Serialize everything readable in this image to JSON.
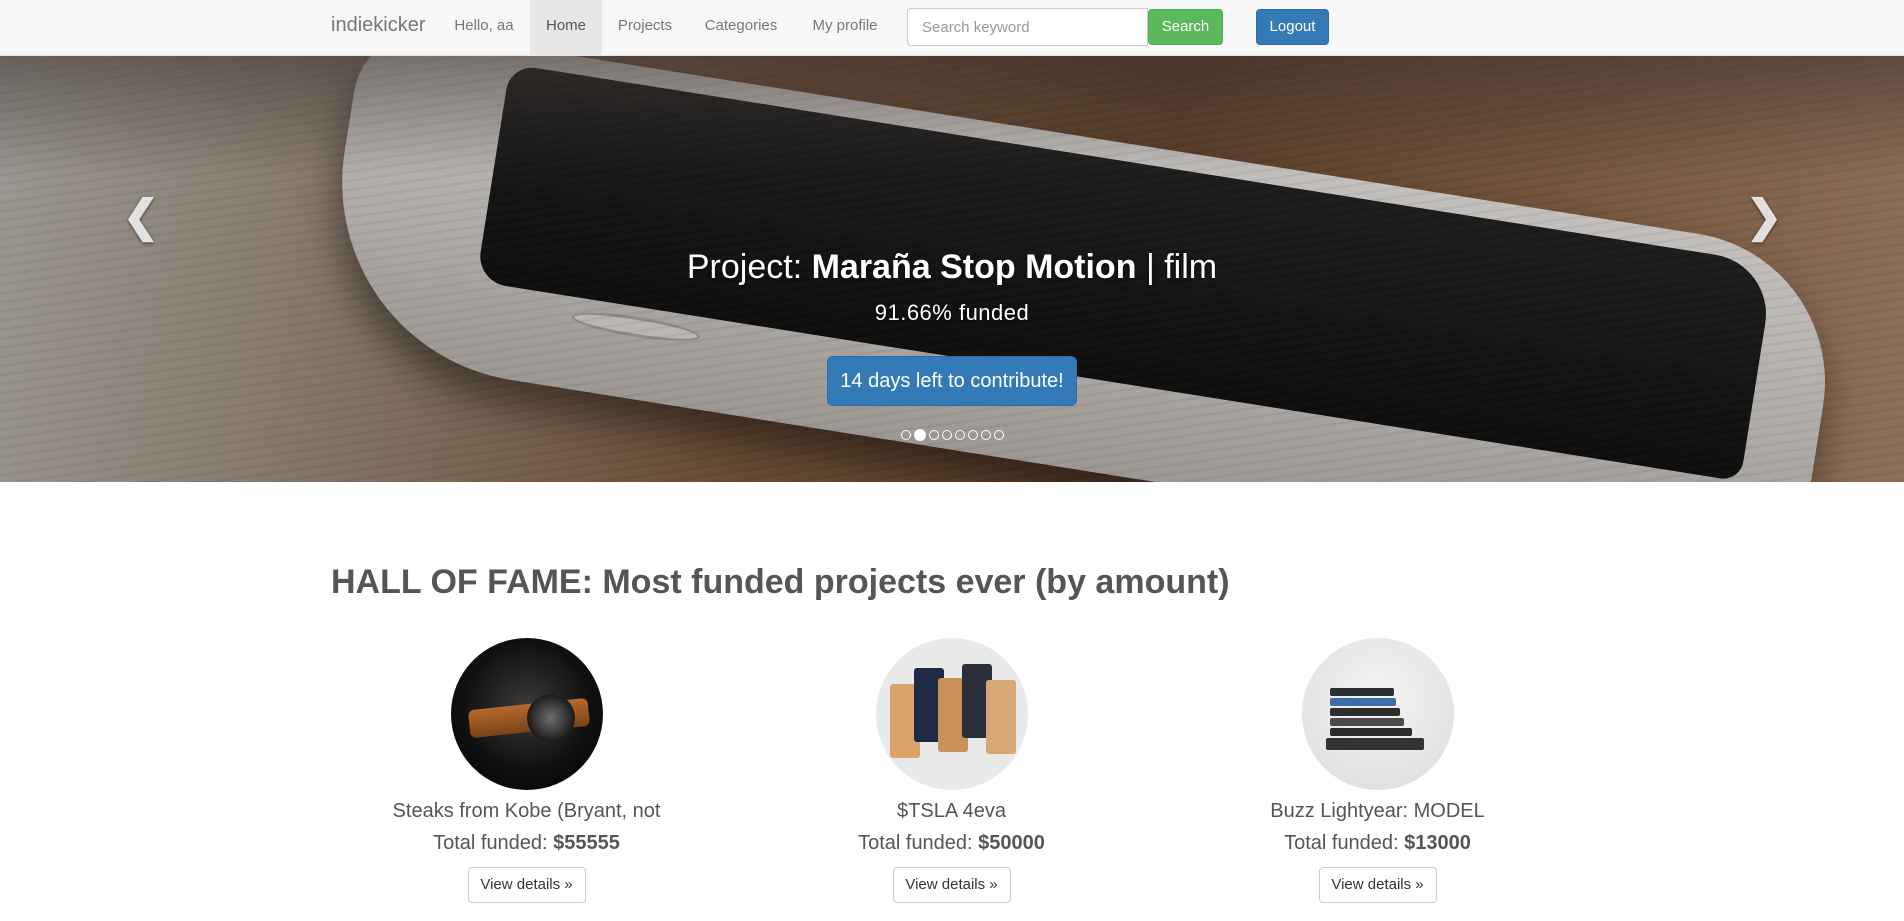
{
  "navbar": {
    "brand": "indiekicker",
    "greeting": "Hello, aa",
    "links": [
      "Home",
      "Projects",
      "Categories",
      "My profile"
    ],
    "search_placeholder": "Search keyword",
    "search_button": "Search",
    "logout_button": "Logout"
  },
  "carousel": {
    "title_prefix": "Project:",
    "project_name": "Maraña Stop Motion",
    "separator": "|",
    "category": "film",
    "funded_text": "91.66% funded",
    "cta_label": "14 days left to contribute!",
    "indicator_count": 8,
    "active_indicator": 1
  },
  "hall_of_fame": {
    "title": "HALL OF FAME: Most funded projects ever (by amount)",
    "funded_label": "Total funded:",
    "details_label": "View details »",
    "projects": [
      {
        "name": "Steaks from Kobe (Bryant, not",
        "amount": "$55555"
      },
      {
        "name": "$TSLA 4eva",
        "amount": "$50000"
      },
      {
        "name": "Buzz Lightyear: MODEL",
        "amount": "$13000"
      }
    ]
  },
  "colors": {
    "primary": "#337ab7",
    "success": "#5cb85c",
    "navbar_bg": "#f8f8f8"
  }
}
